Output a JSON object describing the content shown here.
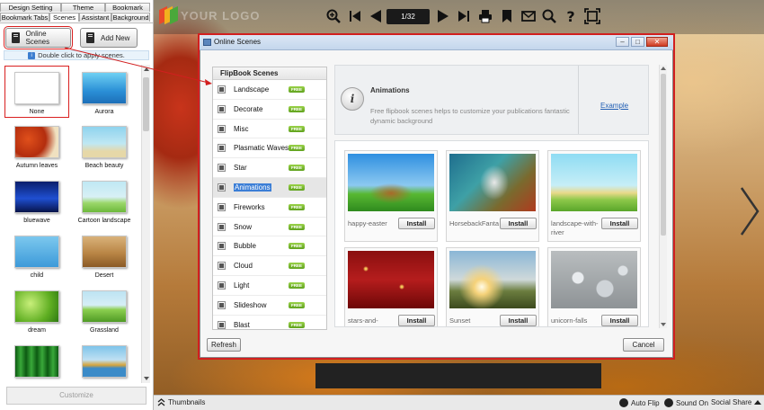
{
  "left_panel": {
    "tabs_row1": [
      "Design Setting",
      "Theme",
      "Bookmark"
    ],
    "tabs_row2": [
      "Bookmark Tabs",
      "Scenes",
      "Assistant",
      "Background"
    ],
    "online_scenes_label": "Online Scenes",
    "add_new_label": "Add New",
    "hint": "Double click to apply scenes.",
    "thumbnails": [
      {
        "label": "None"
      },
      {
        "label": "Aurora"
      },
      {
        "label": "Autumn leaves"
      },
      {
        "label": "Beach beauty"
      },
      {
        "label": "bluewave"
      },
      {
        "label": "Cartoon landscape"
      },
      {
        "label": "child"
      },
      {
        "label": "Desert"
      },
      {
        "label": "dream"
      },
      {
        "label": "Grassland"
      },
      {
        "label": ""
      },
      {
        "label": ""
      }
    ],
    "customize_label": "Customize"
  },
  "toolbar": {
    "logo_text": "YOUR LOGO",
    "page_indicator": "1/32",
    "icons": [
      "zoom-in-icon",
      "first-page-icon",
      "prev-page-icon",
      "next-page-icon",
      "last-page-icon",
      "print-icon",
      "bookmark-icon",
      "email-icon",
      "search-icon",
      "help-icon",
      "fullscreen-icon"
    ]
  },
  "statusbar": {
    "thumbnails_label": "Thumbnails",
    "auto_flip_label": "Auto Flip",
    "sound_label": "Sound On",
    "social_label": "Social Share"
  },
  "dialog": {
    "title": "Online Scenes",
    "category_header": "FlipBook Scenes",
    "free_badge": "FREE",
    "categories": [
      {
        "label": "Landscape"
      },
      {
        "label": "Decorate"
      },
      {
        "label": "Misc"
      },
      {
        "label": "Plasmatic Waves"
      },
      {
        "label": "Star"
      },
      {
        "label": "Animations",
        "selected": true
      },
      {
        "label": "Fireworks"
      },
      {
        "label": "Snow"
      },
      {
        "label": "Bubble"
      },
      {
        "label": "Cloud"
      },
      {
        "label": "Light"
      },
      {
        "label": "Slideshow"
      },
      {
        "label": "Blast"
      }
    ],
    "info_title": "Animations",
    "info_desc": "Free flipbook scenes helps to customize your publications fantastic dynamic background",
    "example_label": "Example",
    "install_label": "Install",
    "scenes": [
      {
        "name": "happy-easter"
      },
      {
        "name": "HorsebackFanta"
      },
      {
        "name": "landscape-with-river"
      },
      {
        "name": "stars-and-"
      },
      {
        "name": "Sunset"
      },
      {
        "name": "unicorn-falls"
      }
    ],
    "refresh_label": "Refresh",
    "cancel_label": "Cancel"
  },
  "colors": {
    "highlight_red": "#d21f1f",
    "selection_blue": "#3b7ed6",
    "free_green": "#5fa11d",
    "link_blue": "#1f5db3"
  }
}
